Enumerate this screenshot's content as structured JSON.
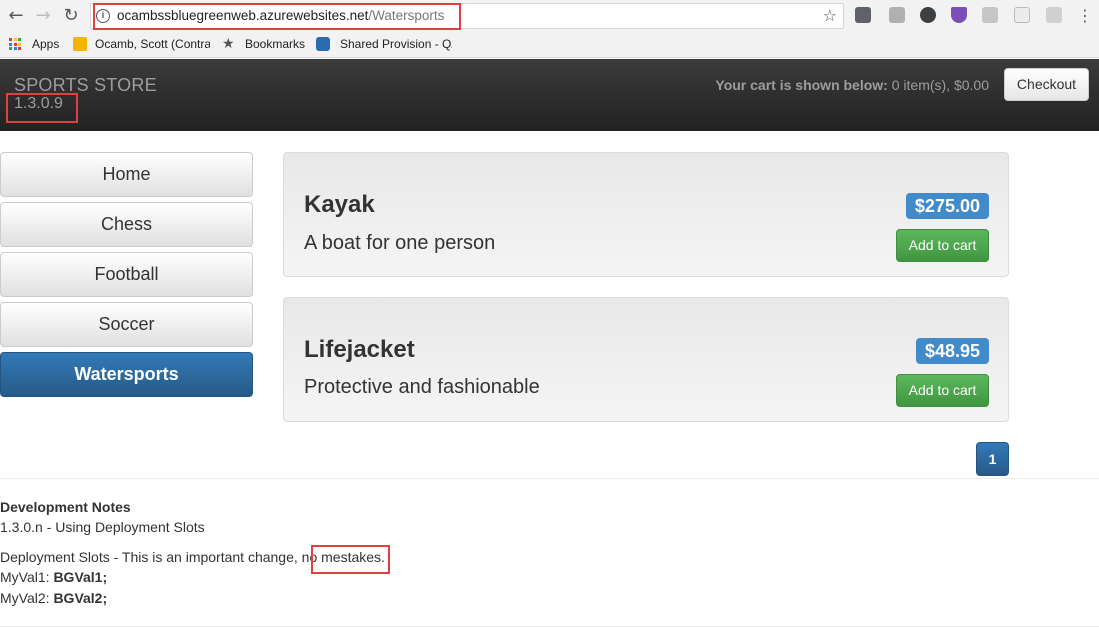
{
  "browser": {
    "url_host": "ocambssbluegreenweb.azurewebsites.net",
    "url_path": "/Watersports",
    "bookmarks": [
      {
        "label": "Apps"
      },
      {
        "label": "Ocamb, Scott (Contra"
      },
      {
        "label": "Bookmarks"
      },
      {
        "label": "Shared Provision - QA"
      }
    ],
    "extensions": [
      "ext-1-icon",
      "ext-2-icon",
      "ext-3-icon",
      "ext-4-icon",
      "ext-5-icon",
      "ext-6-icon",
      "ext-7-icon",
      "menu-icon"
    ]
  },
  "header": {
    "brand": "SPORTS STORE",
    "version": "1.3.0.9",
    "cart_label": "Your cart is shown below:",
    "cart_value": "0 item(s), $0.00",
    "checkout_label": "Checkout"
  },
  "categories": [
    {
      "label": "Home",
      "active": false
    },
    {
      "label": "Chess",
      "active": false
    },
    {
      "label": "Football",
      "active": false
    },
    {
      "label": "Soccer",
      "active": false
    },
    {
      "label": "Watersports",
      "active": true
    }
  ],
  "products": [
    {
      "name": "Kayak",
      "description": "A boat for one person",
      "price": "$275.00",
      "add_label": "Add to cart"
    },
    {
      "name": "Lifejacket",
      "description": "Protective and fashionable",
      "price": "$48.95",
      "add_label": "Add to cart"
    }
  ],
  "pagination": {
    "current": "1"
  },
  "dev_notes": {
    "title": "Development Notes",
    "subtitle": "1.3.0.n - Using Deployment Slots",
    "line1": "Deployment Slots - This is an important change, no mestakes.",
    "val1_label": "MyVal1:",
    "val1": "BGVal1;",
    "val2_label": "MyVal2:",
    "val2": "BGVal2;"
  },
  "colors": {
    "accent": "#337ab7",
    "success": "#5cb85c",
    "price": "#428bca",
    "highlight": "#e04040"
  }
}
